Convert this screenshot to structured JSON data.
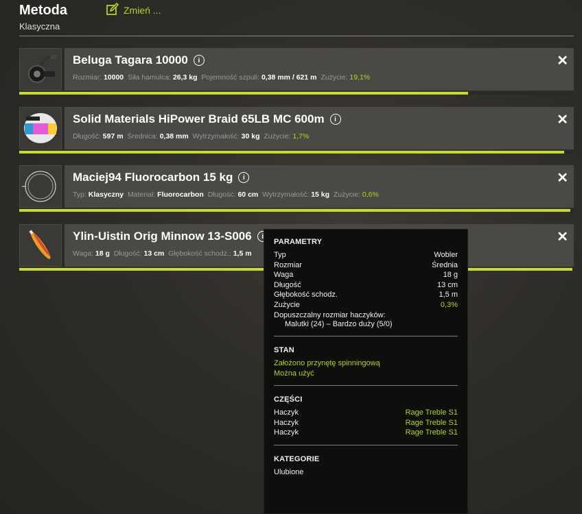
{
  "header": {
    "title": "Metoda",
    "subtitle": "Klasyczna",
    "change_label": "Zmień ..."
  },
  "colors": {
    "accent": "#b5d41c",
    "bar": "#c4dd2a",
    "panel": "#4a4946"
  },
  "items": [
    {
      "name": "Beluga Tagara 10000",
      "wear_fraction": 0.809,
      "stats": [
        {
          "label": "Rozmiar:",
          "value": "10000"
        },
        {
          "label": "Siła hamulca:",
          "value": "26,3 kg"
        },
        {
          "label": "Pojemność szpuli:",
          "value": "0,38 mm / 621 m"
        },
        {
          "label": "Zużycie:",
          "value": "19,1%"
        }
      ]
    },
    {
      "name": "Solid Materials HiPower Braid 65LB MC 600m",
      "wear_fraction": 0.983,
      "stats": [
        {
          "label": "Długość:",
          "value": "597 m"
        },
        {
          "label": "Średnica:",
          "value": "0,38 mm"
        },
        {
          "label": "Wytrzymałość:",
          "value": "30 kg"
        },
        {
          "label": "Zużycie:",
          "value": "1,7%"
        }
      ]
    },
    {
      "name": "Maciej94 Fluorocarbon 15 kg",
      "wear_fraction": 0.994,
      "stats": [
        {
          "label": "Typ:",
          "value": "Klasyczny"
        },
        {
          "label": "Materiał:",
          "value": "Fluorocarbon"
        },
        {
          "label": "Długość:",
          "value": "60 cm"
        },
        {
          "label": "Wytrzymałość:",
          "value": "15 kg"
        },
        {
          "label": "Zużycie:",
          "value": "0,6%"
        }
      ]
    },
    {
      "name": "Ylin-Uistin Orig Minnow 13-S006",
      "wear_fraction": 0.997,
      "stats": [
        {
          "label": "Waga:",
          "value": "18 g"
        },
        {
          "label": "Długość:",
          "value": "13 cm"
        },
        {
          "label": "Głębokość schodz.:",
          "value": "1,5 m"
        }
      ]
    }
  ],
  "tooltip": {
    "params_title": "PARAMETRY",
    "params": [
      {
        "label": "Typ",
        "value": "Wobler"
      },
      {
        "label": "Rozmiar",
        "value": "Średnia"
      },
      {
        "label": "Waga",
        "value": "18 g"
      },
      {
        "label": "Długość",
        "value": "13 cm"
      },
      {
        "label": "Głębokość schodz.",
        "value": "1,5 m"
      },
      {
        "label": "Zużycie",
        "value": "0,3%"
      }
    ],
    "hook_size_label": "Dopuszczalny rozmiar haczyków:",
    "hook_size_value": "Malutki (24) – Bardzo duży (5/0)",
    "state_title": "STAN",
    "state_lines": [
      "Założono przynętę spinningową",
      "Można użyć"
    ],
    "parts_title": "CZĘŚCI",
    "parts": [
      {
        "label": "Haczyk",
        "value": "Rage Treble S1"
      },
      {
        "label": "Haczyk",
        "value": "Rage Treble S1"
      },
      {
        "label": "Haczyk",
        "value": "Rage Treble S1"
      }
    ],
    "categories_title": "KATEGORIE",
    "categories_value": "Ulubione"
  }
}
